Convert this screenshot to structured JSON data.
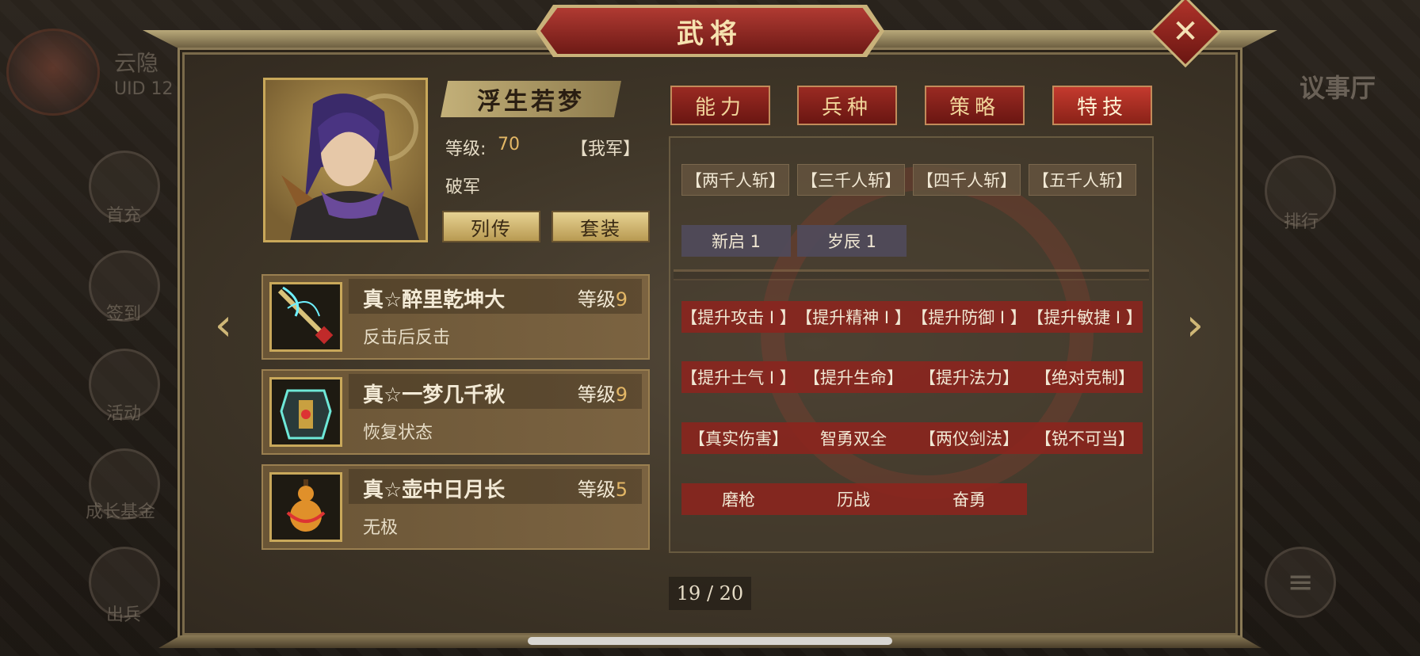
{
  "window": {
    "title": "武将",
    "close_icon": "close-icon"
  },
  "background": {
    "player_name": "云隐",
    "player_uid": "UID  12",
    "right_title": "议事厅",
    "side_left": [
      "首充",
      "签到",
      "活动",
      "成长基金",
      "出兵"
    ],
    "side_right": [
      "排行"
    ]
  },
  "general": {
    "name": "浮生若梦",
    "level_label": "等级:",
    "level_value": "70",
    "faction": "【我军】",
    "class": "破军",
    "btn_biography": "列传",
    "btn_suit": "套装"
  },
  "equipment": [
    {
      "name": "真☆醉里乾坤大",
      "level_label": "等级",
      "level": "9",
      "desc": "反击后反击",
      "icon": "sword-icon"
    },
    {
      "name": "真☆一梦几千秋",
      "level_label": "等级",
      "level": "9",
      "desc": "恢复状态",
      "icon": "armor-icon"
    },
    {
      "name": "真☆壶中日月长",
      "level_label": "等级",
      "level": "5",
      "desc": "无极",
      "icon": "gourd-icon"
    }
  ],
  "tabs": [
    {
      "label": "能力",
      "active": false
    },
    {
      "label": "兵种",
      "active": false
    },
    {
      "label": "策略",
      "active": false
    },
    {
      "label": "特技",
      "active": true
    }
  ],
  "skills": {
    "row1": [
      "【两千人斩】",
      "【三千人斩】",
      "【四千人斩】",
      "【五千人斩】"
    ],
    "row2": [
      "新启 1",
      "岁辰 1"
    ],
    "row3": [
      "【提升攻击 I 】",
      "【提升精神 I 】",
      "【提升防御 I 】",
      "【提升敏捷 I 】"
    ],
    "row4": [
      "【提升士气 I 】",
      "【提升生命】",
      "【提升法力】",
      "【绝对克制】"
    ],
    "row5": [
      "【真实伤害】",
      "智勇双全",
      "【两仪剑法】",
      "【锐不可当】"
    ],
    "row6": [
      "磨枪",
      "历战",
      "奋勇"
    ]
  },
  "pagination": {
    "text": "19 / 20"
  },
  "colors": {
    "accent_red": "#9a2a22",
    "gold": "#c9a85a",
    "level_gold": "#e3b766"
  }
}
